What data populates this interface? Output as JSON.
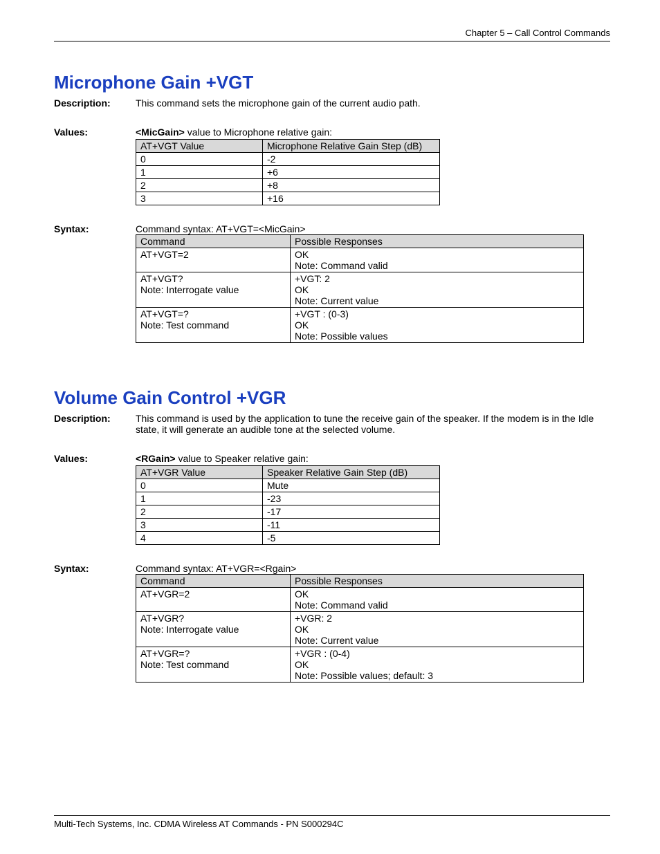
{
  "header": {
    "chapter": "Chapter 5 – Call Control Commands"
  },
  "sec1": {
    "title": "Microphone Gain  +VGT",
    "desc_label": "Description:",
    "desc_text": "This command sets the microphone gain of the current audio path.",
    "values_label": "Values:",
    "values_intro_bold": "<MicGain>",
    "values_intro_rest": " value to Microphone relative gain:",
    "values_head": [
      "AT+VGT Value",
      "Microphone Relative Gain Step (dB)"
    ],
    "values_rows": [
      [
        "0",
        "-2"
      ],
      [
        "1",
        "+6"
      ],
      [
        "2",
        "+8"
      ],
      [
        "3",
        "+16"
      ]
    ],
    "syntax_label": "Syntax:",
    "syntax_text": "Command syntax: AT+VGT=<MicGain>",
    "syntax_head": [
      "Command",
      "Possible Responses"
    ],
    "syntax_rows": [
      {
        "c": [
          "AT+VGT=2"
        ],
        "r": [
          "OK",
          "Note: Command valid"
        ]
      },
      {
        "c": [
          "AT+VGT?",
          "Note: Interrogate value"
        ],
        "r": [
          "+VGT: 2",
          "OK",
          "Note: Current value"
        ]
      },
      {
        "c": [
          "AT+VGT=?",
          "Note: Test command"
        ],
        "r": [
          "+VGT : (0-3)",
          "OK",
          "Note: Possible values"
        ]
      }
    ]
  },
  "sec2": {
    "title": "Volume Gain Control  +VGR",
    "desc_label": "Description:",
    "desc_text": "This command is used by the application to tune the receive gain of the speaker. If the modem is in the Idle state, it will generate an audible tone at the selected volume.",
    "values_label": "Values:",
    "values_intro_bold": "<RGain>",
    "values_intro_rest": " value to Speaker relative gain:",
    "values_head": [
      "AT+VGR Value",
      "Speaker Relative Gain Step (dB)"
    ],
    "values_rows": [
      [
        "0",
        "Mute"
      ],
      [
        "1",
        "-23"
      ],
      [
        "2",
        "-17"
      ],
      [
        "3",
        "-11"
      ],
      [
        "4",
        "-5"
      ]
    ],
    "syntax_label": "Syntax:",
    "syntax_text": "Command syntax: AT+VGR=<Rgain>",
    "syntax_head": [
      "Command",
      "Possible Responses"
    ],
    "syntax_rows": [
      {
        "c": [
          "AT+VGR=2"
        ],
        "r": [
          "OK",
          "Note: Command valid"
        ]
      },
      {
        "c": [
          "AT+VGR?",
          "Note: Interrogate value"
        ],
        "r": [
          "+VGR: 2",
          "OK",
          "Note: Current value"
        ]
      },
      {
        "c": [
          "AT+VGR=?",
          "Note: Test command"
        ],
        "r": [
          "+VGR : (0-4)",
          "OK",
          "Note: Possible values; default: 3"
        ]
      }
    ]
  },
  "footer": {
    "text": "Multi-Tech Systems, Inc. CDMA Wireless AT Commands - PN S000294C"
  }
}
